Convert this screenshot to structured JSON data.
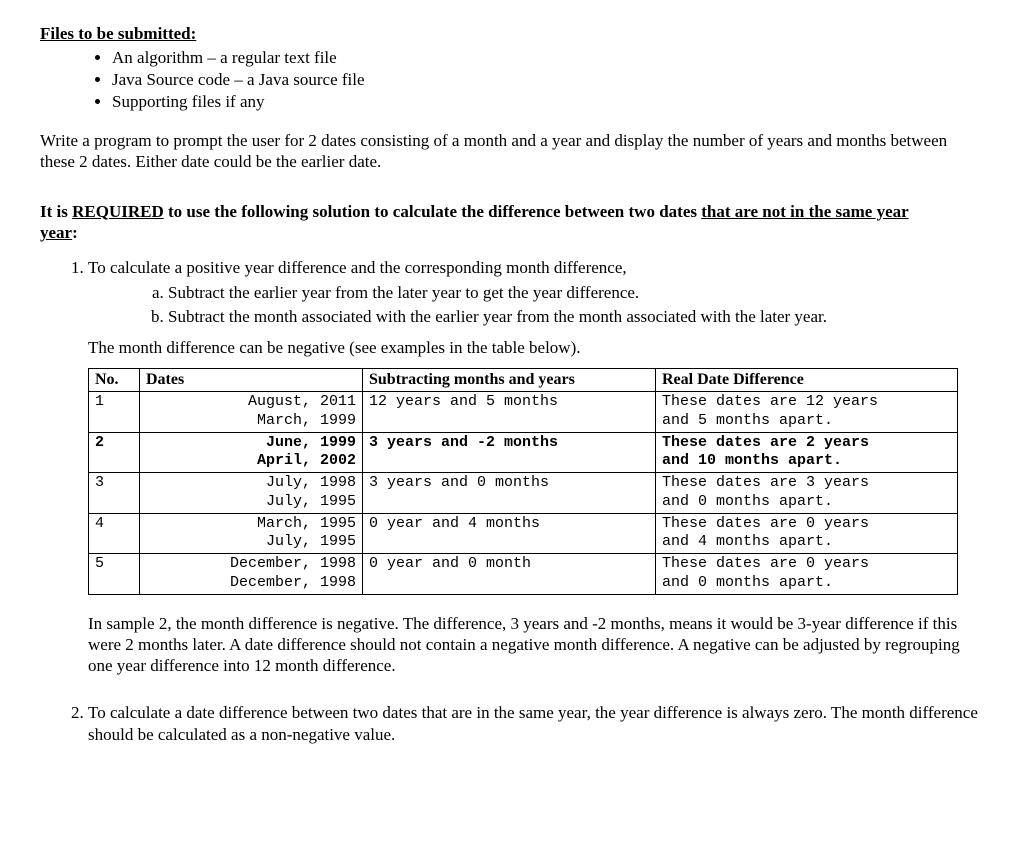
{
  "filesHeading": "Files to be submitted:",
  "files": [
    "An algorithm – a regular text file",
    "Java Source code – a Java source file",
    "Supporting files if any"
  ],
  "intro": "Write a program to prompt the user for 2 dates consisting of a month and a year and display the number of years and months between these 2 dates. Either date could be the earlier date.",
  "requiredPrefix": "It is ",
  "requiredWord": "REQUIRED",
  "requiredMid": " to use the following solution to calculate the difference between two dates ",
  "requiredUnderline": "that are not in the same year",
  "requiredSuffix": ":",
  "step1": "To calculate a positive year difference and the corresponding month difference,",
  "step1a": "Subtract the earlier year from the later year to get the year difference.",
  "step1b": "Subtract the month associated with the earlier year from the month associated with the later year.",
  "noteNeg": "The month difference can be negative (see examples in the table below).",
  "tableHeaders": {
    "no": "No.",
    "dates": "Dates",
    "sub": "Subtracting months and years",
    "real": "Real Date Difference"
  },
  "rows": [
    {
      "no": "1",
      "date1": "August, 2011",
      "date2": "March, 1999",
      "sub": "12 years and 5 months",
      "real1": "These dates are 12 years",
      "real2": "and 5 months apart.",
      "bold": false
    },
    {
      "no": "2",
      "date1": "June, 1999",
      "date2": "April, 2002",
      "sub": "3 years and -2 months",
      "real1": "These dates are 2 years",
      "real2": "and 10 months apart.",
      "bold": true
    },
    {
      "no": "3",
      "date1": "July, 1998",
      "date2": "July, 1995",
      "sub": "3 years and 0 months",
      "real1": "These dates are 3 years",
      "real2": "and 0 months apart.",
      "bold": false
    },
    {
      "no": "4",
      "date1": "March, 1995",
      "date2": "July, 1995",
      "sub": "0 year and 4 months",
      "real1": "These dates are 0 years",
      "real2": "and 4 months apart.",
      "bold": false
    },
    {
      "no": "5",
      "date1": "December, 1998",
      "date2": "December, 1998",
      "sub": "0 year and 0 month",
      "real1": "These dates are 0 years",
      "real2": "and 0 months apart.",
      "bold": false
    }
  ],
  "explain": "In sample 2, the month difference is negative.   The difference, 3 years and -2 months, means it would be 3-year difference if this were 2 months later. A date difference should not contain a negative month difference. A negative can be adjusted by regrouping one year difference into 12 month difference.",
  "step2": "To calculate a date difference between two dates that are in the same year, the year difference is always zero. The month difference should be calculated as a non-negative value."
}
